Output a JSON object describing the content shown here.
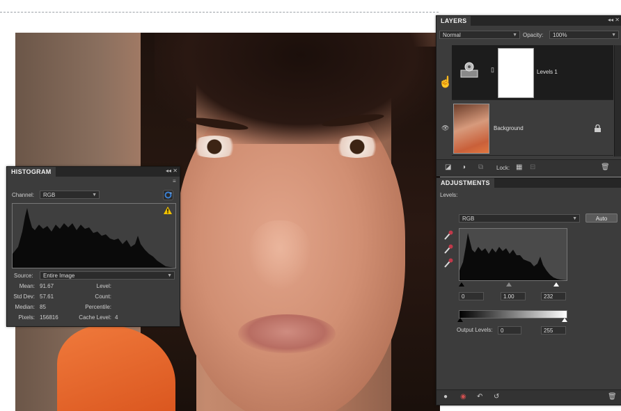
{
  "histogram": {
    "title": "HISTOGRAM",
    "channel_label": "Channel:",
    "channel_value": "RGB",
    "source_label": "Source:",
    "source_value": "Entire Image",
    "stats_left": [
      {
        "label": "Mean:",
        "value": "91.67"
      },
      {
        "label": "Std Dev:",
        "value": "57.61"
      },
      {
        "label": "Median:",
        "value": "85"
      },
      {
        "label": "Pixels:",
        "value": "156816"
      }
    ],
    "stats_right": [
      {
        "label": "Level:",
        "value": ""
      },
      {
        "label": "Count:",
        "value": ""
      },
      {
        "label": "Percentile:",
        "value": ""
      },
      {
        "label": "Cache Level:",
        "value": "4"
      }
    ]
  },
  "layers": {
    "title": "LAYERS",
    "blend_mode": "Normal",
    "opacity_label": "Opacity:",
    "opacity_value": "100%",
    "items": [
      {
        "name": "Levels 1",
        "selected": true
      },
      {
        "name": "Background",
        "selected": false
      }
    ],
    "lock_label": "Lock:"
  },
  "adjustments": {
    "title": "ADJUSTMENTS",
    "subtitle": "Levels:",
    "channel_value": "RGB",
    "auto_label": "Auto",
    "input_black": "0",
    "input_gamma": "1.00",
    "input_white": "232",
    "output_label": "Output Levels:",
    "output_black": "0",
    "output_white": "255"
  },
  "colors": {
    "panel_bg": "#3c3c3c",
    "panel_dark": "#262626",
    "warning": "#f2c200",
    "refresh": "#3b7fd0"
  }
}
